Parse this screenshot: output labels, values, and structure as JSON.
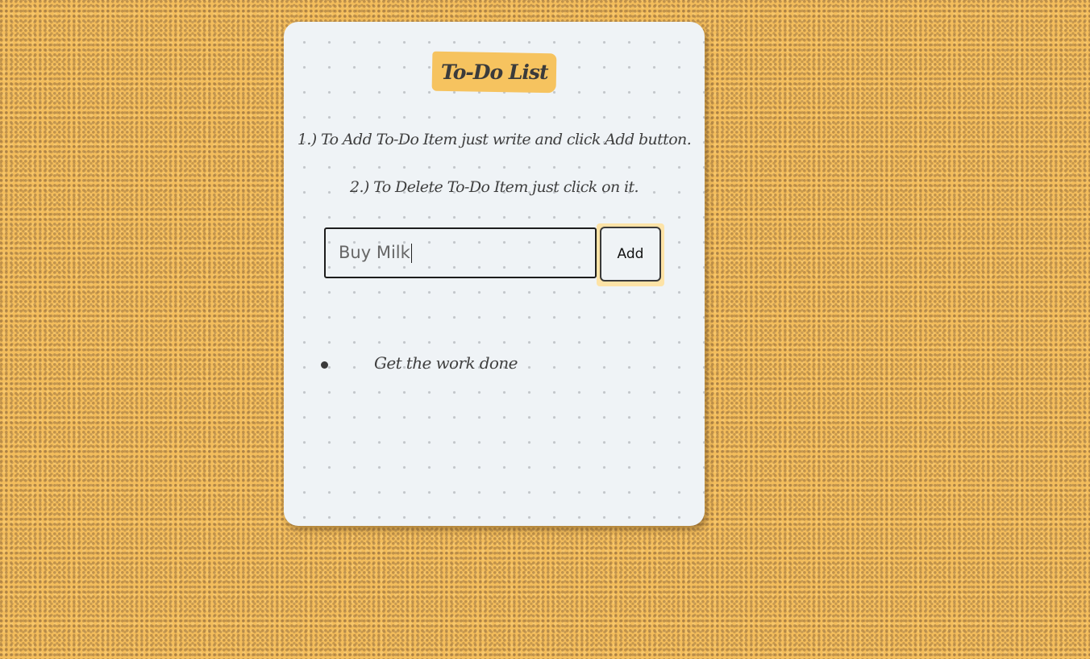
{
  "app": {
    "title": "To-Do List"
  },
  "instructions": [
    "1.) To Add To-Do Item just write and click Add button.",
    "2.) To Delete To-Do Item just click on it."
  ],
  "input": {
    "value": "Buy Milk",
    "placeholder": ""
  },
  "add_button": {
    "label": "Add"
  },
  "todos": [
    {
      "text": "Get the work done"
    }
  ],
  "colors": {
    "background": "#f3bd5c",
    "card": "#eff3f6",
    "title_highlight": "#f6c35f",
    "button_highlight": "#fde3a7",
    "text": "#3f3f3f"
  }
}
